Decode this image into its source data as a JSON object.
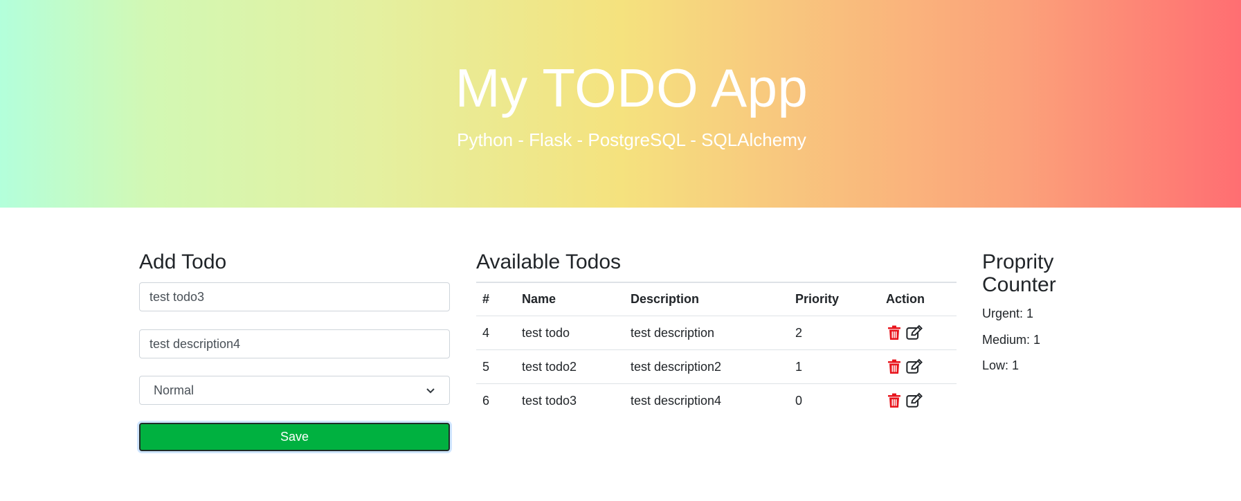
{
  "hero": {
    "title": "My TODO App",
    "subtitle": "Python - Flask - PostgreSQL - SQLAlchemy"
  },
  "add_todo": {
    "heading": "Add Todo",
    "name_value": "test todo3",
    "description_value": "test description4",
    "priority_selected": "Normal",
    "save_label": "Save"
  },
  "todos": {
    "heading": "Available Todos",
    "columns": [
      "#",
      "Name",
      "Description",
      "Priority",
      "Action"
    ],
    "rows": [
      {
        "id": "4",
        "name": "test todo",
        "description": "test description",
        "priority": "2"
      },
      {
        "id": "5",
        "name": "test todo2",
        "description": "test description2",
        "priority": "1"
      },
      {
        "id": "6",
        "name": "test todo3",
        "description": "test description4",
        "priority": "0"
      }
    ],
    "action_icons": [
      "trash-icon",
      "edit-icon"
    ]
  },
  "counter": {
    "heading_line1": "Proprity",
    "heading_line2": "Counter",
    "items": [
      "Urgent: 1",
      "Medium: 1",
      "Low: 1"
    ]
  },
  "colors": {
    "save_button": "#00b140",
    "delete_icon": "#e8141c",
    "gradient_start": "#b3ffdb",
    "gradient_mid": "#f5e27e",
    "gradient_end": "#ff6e72"
  }
}
